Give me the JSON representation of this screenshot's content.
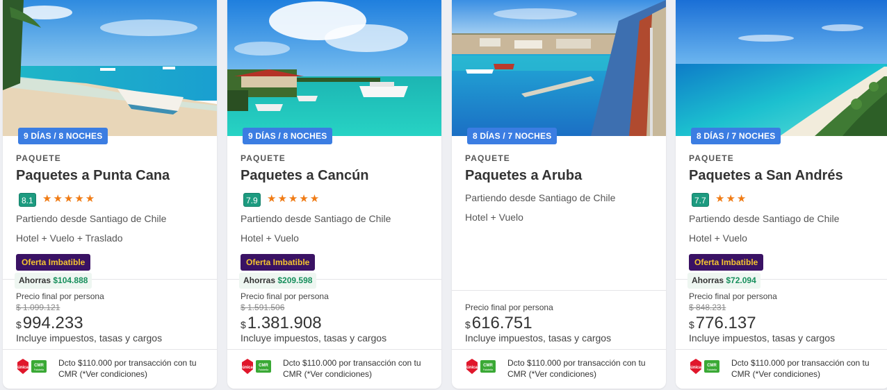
{
  "cards": [
    {
      "nights": "9 DÍAS / 8 NOCHES",
      "type": "PAQUETE",
      "title": "Paquetes a Punta Cana",
      "rating": "8.1",
      "stars": "★★★★★",
      "departure": "Partiendo desde Santiago de Chile",
      "includes": "Hotel + Vuelo + Traslado",
      "offer_badge": "Oferta Imbatible",
      "savings_label": "Ahorras",
      "savings_amount": "$104.888",
      "price_label": "Precio final por persona",
      "old_price": "$ 1.099.121",
      "currency": "$",
      "price": "994.233",
      "taxes": "Incluye impuestos, tasas y cargos",
      "promo_text": "Dcto $110.000 por transacción con tu CMR (*Ver condiciones)"
    },
    {
      "nights": "9 DÍAS / 8 NOCHES",
      "type": "PAQUETE",
      "title": "Paquetes a Cancún",
      "rating": "7.9",
      "stars": "★★★★★",
      "departure": "Partiendo desde Santiago de Chile",
      "includes": "Hotel + Vuelo",
      "offer_badge": "Oferta Imbatible",
      "savings_label": "Ahorras",
      "savings_amount": "$209.598",
      "price_label": "Precio final por persona",
      "old_price": "$ 1.591.506",
      "currency": "$",
      "price": "1.381.908",
      "taxes": "Incluye impuestos, tasas y cargos",
      "promo_text": "Dcto $110.000 por transacción con tu CMR (*Ver condiciones)"
    },
    {
      "nights": "8 DÍAS / 7 NOCHES",
      "type": "PAQUETE",
      "title": "Paquetes a Aruba",
      "departure": "Partiendo desde Santiago de Chile",
      "includes": "Hotel + Vuelo",
      "price_label": "Precio final por persona",
      "currency": "$",
      "price": "616.751",
      "taxes": "Incluye impuestos, tasas y cargos",
      "promo_text": "Dcto $110.000 por transacción con tu CMR (*Ver condiciones)"
    },
    {
      "nights": "8 DÍAS / 7 NOCHES",
      "type": "PAQUETE",
      "title": "Paquetes a San Andrés",
      "rating": "7.7",
      "stars": "★★★",
      "departure": "Partiendo desde Santiago de Chile",
      "includes": "Hotel + Vuelo",
      "offer_badge": "Oferta Imbatible",
      "savings_label": "Ahorras",
      "savings_amount": "$72.094",
      "price_label": "Precio final por persona",
      "old_price": "$ 848.231",
      "currency": "$",
      "price": "776.137",
      "taxes": "Incluye impuestos, tasas y cargos",
      "promo_text": "Dcto $110.000 por transacción con tu CMR (*Ver condiciones)"
    }
  ],
  "logos": {
    "unica": "única",
    "cmr": "CMR",
    "cmr_sub": "Falabella"
  },
  "colors": {
    "nights_badge": "#3b7de2",
    "offer_badge_bg": "#3a1264",
    "offer_badge_text": "#f4c430",
    "rating_bg": "#1d9b80",
    "stars": "#f07b14",
    "savings_amount": "#178f5c"
  }
}
